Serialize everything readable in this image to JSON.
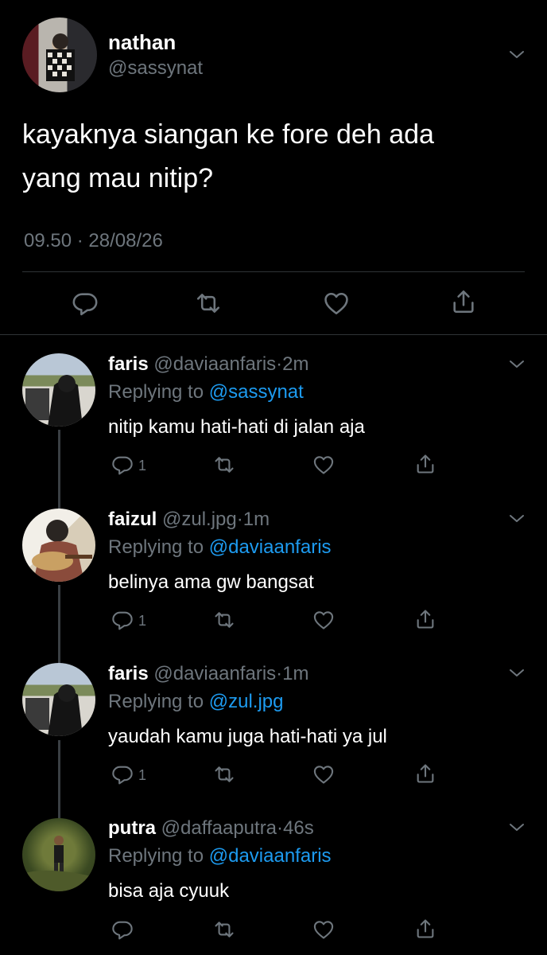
{
  "main_tweet": {
    "name": "nathan",
    "handle": "@sassynat",
    "text_line1": "kayaknya siangan ke fore deh ada",
    "text_line2": "yang mau nitip?",
    "time": "09.50",
    "separator": "·",
    "date": "28/08/26"
  },
  "replies": [
    {
      "name": "faris",
      "handle": "@daviaanfaris",
      "dot": "·",
      "time": "2m",
      "replying_label": "Replying to",
      "replying_to": "@sassynat",
      "text": "nitip kamu hati-hati di jalan aja",
      "reply_count": "1"
    },
    {
      "name": "faizul",
      "handle": "@zul.jpg",
      "dot": "·",
      "time": "1m",
      "replying_label": "Replying to",
      "replying_to": "@daviaanfaris",
      "text": "belinya ama gw bangsat",
      "reply_count": "1"
    },
    {
      "name": "faris",
      "handle": "@daviaanfaris",
      "dot": "·",
      "time": "1m",
      "replying_label": "Replying to",
      "replying_to": "@zul.jpg",
      "text": "yaudah kamu juga hati-hati ya jul",
      "reply_count": "1"
    },
    {
      "name": "putra",
      "handle": "@daffaaputra",
      "dot": "·",
      "time": "46s",
      "replying_label": "Replying to",
      "replying_to": "@daviaanfaris",
      "text": "bisa aja cyuuk",
      "reply_count": ""
    }
  ],
  "icons": {
    "more": "chevron-down-icon",
    "reply": "reply-icon",
    "retweet": "retweet-icon",
    "like": "heart-icon",
    "share": "share-icon"
  },
  "colors": {
    "background": "#000000",
    "text": "#ffffff",
    "muted": "#6e767d",
    "link": "#1d9bf0",
    "divider": "#2f3336"
  }
}
